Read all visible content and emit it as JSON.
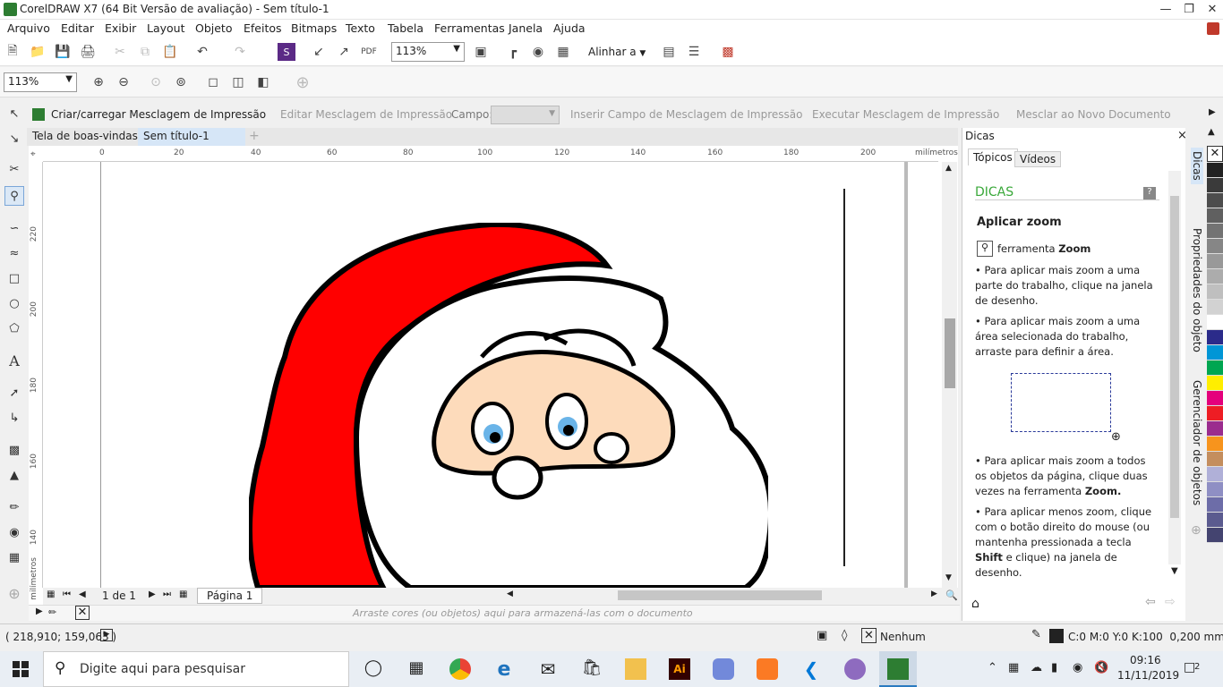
{
  "window": {
    "title": "CorelDRAW X7 (64 Bit Versão de avaliação) - Sem título-1"
  },
  "menu": [
    "Arquivo",
    "Editar",
    "Exibir",
    "Layout",
    "Objeto",
    "Efeitos",
    "Bitmaps",
    "Texto",
    "Tabela",
    "Ferramentas",
    "Janela",
    "Ajuda"
  ],
  "toolbar": {
    "zoom_value": "113%",
    "align_label": "Alinhar a"
  },
  "toolbar2": {
    "zoom_value": "113%"
  },
  "mergebar": {
    "create": "Criar/carregar Mesclagem de Impressão",
    "edit": "Editar Mesclagem de Impressão",
    "field_label": "Campo:",
    "insert": "Inserir Campo de Mesclagem de Impressão",
    "execute": "Executar Mesclagem de Impressão",
    "merge_new": "Mesclar ao Novo Documento"
  },
  "doc_tabs": [
    "Tela de boas-vindas",
    "Sem título-1"
  ],
  "ruler": {
    "unit": "milímetros",
    "h_ticks": [
      "0",
      "20",
      "40",
      "60",
      "80",
      "100",
      "120",
      "140",
      "160",
      "180",
      "200"
    ],
    "v_ticks": [
      "220",
      "200",
      "180",
      "160",
      "140"
    ]
  },
  "pagebar": {
    "count": "1 de 1",
    "page_tab": "Página 1"
  },
  "colorbar_hint": "Arraste cores (ou objetos) aqui para armazená-las com o documento",
  "docker": {
    "title": "Dicas",
    "tabs": [
      "Tópicos",
      "Vídeos"
    ],
    "heading": "DICAS",
    "subheading": "Aplicar zoom",
    "tool_text": "ferramenta",
    "tool_name": "Zoom",
    "bullets": [
      "Para aplicar mais zoom a uma parte do trabalho, clique na janela de desenho.",
      "Para aplicar mais zoom a uma área selecionada do trabalho, arraste para definir a área."
    ],
    "bullet3_text": "Para aplicar mais zoom a todos os objetos da página, clique duas vezes na ferramenta",
    "bullet3_bold": "Zoom.",
    "bullet4_a": "Para aplicar menos zoom, clique com o botão direito do mouse (ou mantenha pressionada a tecla",
    "bullet4_bold": "Shift",
    "bullet4_b": "e clique) na janela de desenho."
  },
  "side_tabs": [
    "Dicas",
    "Propriedades do objeto",
    "Gerenciador de objetos"
  ],
  "palette": [
    "#ffffff",
    "#222222",
    "#3a3a3a",
    "#4d4d4d",
    "#606060",
    "#737373",
    "#868686",
    "#999999",
    "#acacac",
    "#bfbfbf",
    "#d2d2d2",
    "#ffffff",
    "#2b2b8a",
    "#0096d6",
    "#00a651",
    "#ffee00",
    "#e4007c",
    "#ee1d24",
    "#9b2c8e",
    "#f7941d",
    "#c48e5e",
    "#b0b0d8",
    "#8f8fc4",
    "#6d6da8",
    "#5b5b8f",
    "#444470"
  ],
  "status": {
    "coords": "( 218,910; 159,063 )",
    "fill": "Nenhum",
    "outline": "C:0 M:0 Y:0 K:100  0,200 mm"
  },
  "taskbar": {
    "search_placeholder": "Digite aqui para pesquisar",
    "time": "09:16",
    "date": "11/11/2019",
    "badge": "2"
  }
}
